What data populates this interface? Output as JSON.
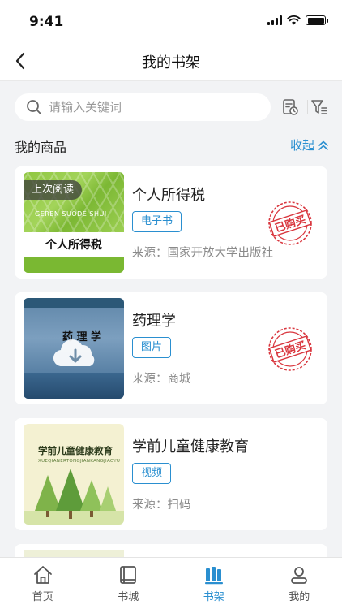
{
  "status": {
    "time": "9:41"
  },
  "nav": {
    "title": "我的书架"
  },
  "search": {
    "placeholder": "请输入关键词"
  },
  "section": {
    "title": "我的商品",
    "collapse_label": "收起"
  },
  "books": [
    {
      "title": "个人所得税",
      "type": "电子书",
      "source": "来源：国家开放大学出版社",
      "last_read_badge": "上次阅读",
      "purchased_stamp": "已购买",
      "cover": {
        "title": "个人所得税",
        "pinyin": "GEREN SUODE SHUI"
      }
    },
    {
      "title": "药理学",
      "type": "图片",
      "source": "来源：商城",
      "purchased_stamp": "已购买",
      "cover": {
        "title": "药 理 学"
      }
    },
    {
      "title": "学前儿童健康教育",
      "type": "视频",
      "source": "来源：扫码",
      "cover": {
        "title": "学前儿童健康教育",
        "pinyin": "XUEQIANERTONGJIANKANGJIAOYU"
      }
    }
  ],
  "tabs": [
    {
      "label": "首页",
      "icon": "home-icon",
      "active": false
    },
    {
      "label": "书城",
      "icon": "book-icon",
      "active": false
    },
    {
      "label": "书架",
      "icon": "bookshelf-icon",
      "active": true
    },
    {
      "label": "我的",
      "icon": "user-icon",
      "active": false
    }
  ],
  "colors": {
    "accent": "#2a8fd0",
    "stamp": "#d9363e",
    "background": "#f2f3f5"
  }
}
